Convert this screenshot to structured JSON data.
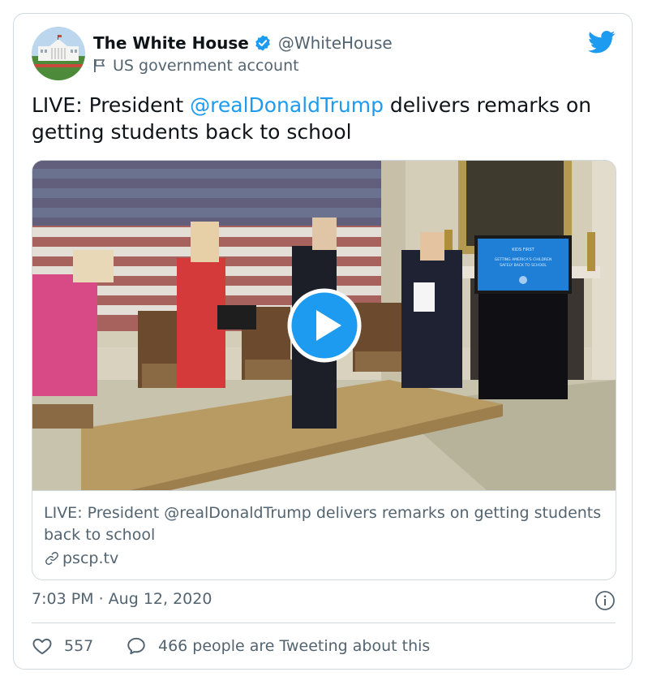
{
  "tweet": {
    "author_name": "The White House",
    "author_handle": "@WhiteHouse",
    "account_label": "US government account",
    "text_prefix": "LIVE: President ",
    "mention": "@realDonaldTrump",
    "text_suffix": " delivers remarks on getting students back to school",
    "timestamp": "7:03 PM · Aug 12, 2020"
  },
  "card": {
    "title": "LIVE: President @realDonaldTrump delivers remarks on getting students back to school",
    "domain": "pscp.tv"
  },
  "video_screen": {
    "line1": "KIDS FIRST",
    "line2": "GETTING AMERICA'S CHILDREN",
    "line3": "SAFELY BACK TO SCHOOL"
  },
  "actions": {
    "like_count": "557",
    "reply_label": "466 people are Tweeting about this"
  },
  "icons": {
    "verified": "verified-badge-icon",
    "government": "flag-icon",
    "platform": "twitter-bird-icon",
    "play": "play-icon",
    "link": "link-icon",
    "info": "info-icon",
    "like": "heart-icon",
    "reply": "speech-bubble-icon"
  },
  "colors": {
    "accent": "#1d9bf0",
    "text": "#0f1419",
    "secondary": "#536471",
    "border": "#cfd9de"
  }
}
